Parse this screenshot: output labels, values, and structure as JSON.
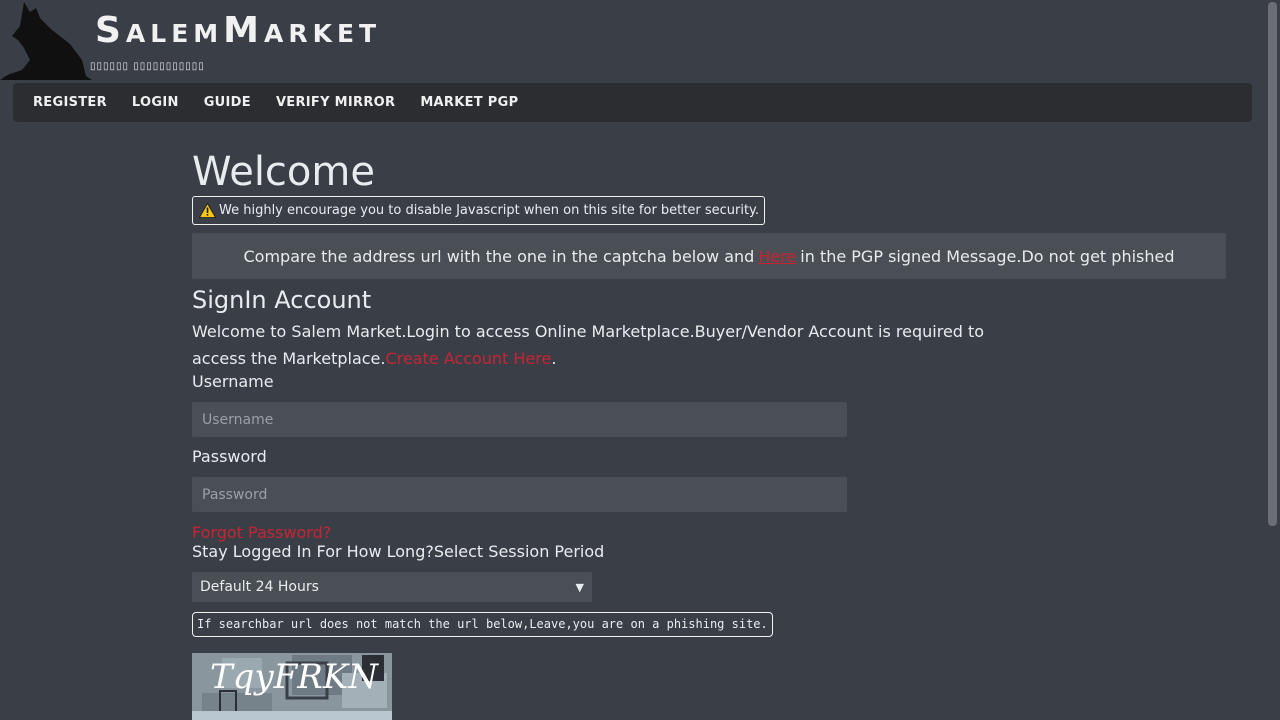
{
  "brand": {
    "title": "SalemMarket",
    "subtitle": "▯▯▯▯▯▯ ▯▯▯▯▯▯▯▯▯▯▯"
  },
  "nav": {
    "items": [
      "REGISTER",
      "LOGIN",
      "GUIDE",
      "VERIFY MIRROR",
      "MARKET PGP"
    ]
  },
  "main": {
    "heading": "Welcome",
    "js_alert": "We highly encourage you to disable Javascript when on this site for better security.",
    "compare": {
      "before": "Compare the address url with the one in the captcha below and",
      "link": "Here",
      "after": "in the PGP signed Message.Do not get phished"
    },
    "signin_title": "SignIn Account",
    "intro": "Welcome to Salem Market.Login to access Online Marketplace.Buyer/Vendor Account is required to access the Marketplace.",
    "create_link": "Create Account Here",
    "intro_end": ".",
    "username_label": "Username",
    "username_placeholder": "Username",
    "password_label": "Password",
    "password_placeholder": "Password",
    "forgot": "Forgot Password?",
    "stay_label": "Stay Logged In For How Long?Select Session Period",
    "session_selected": "Default 24 Hours",
    "phish_note": "If searchbar url does not match the url below,Leave,you are on a phishing site.",
    "captcha_text": "TqyFRKN"
  },
  "colors": {
    "background": "#3a3f47",
    "navbar": "#2b2d30",
    "link_red": "#c82333",
    "input_bg": "#4a4f56"
  }
}
